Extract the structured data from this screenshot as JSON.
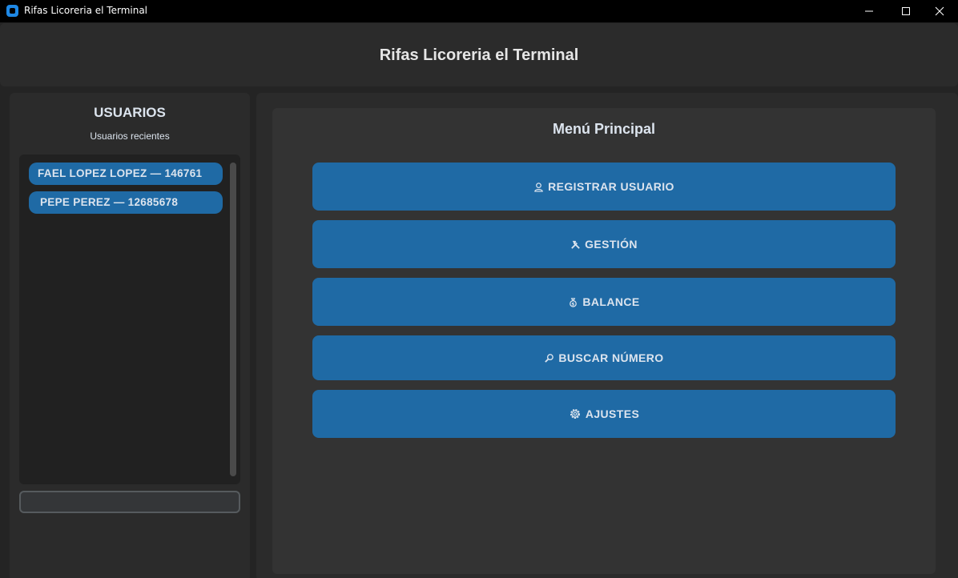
{
  "window": {
    "title": "Rifas Licoreria el Terminal",
    "controls": [
      "minimize-icon",
      "maximize-icon",
      "close-icon"
    ]
  },
  "header": {
    "title": "Rifas Licoreria el Terminal"
  },
  "sidebar": {
    "title": "USUARIOS",
    "subtitle": "Usuarios recientes",
    "users": [
      "FAEL LOPEZ LOPEZ  —  146761",
      "PEPE  PEREZ  —  12685678"
    ],
    "search": {
      "value": "",
      "placeholder": ""
    }
  },
  "main": {
    "title": "Menú Principal",
    "buttons": [
      {
        "label": "REGISTRAR USUARIO",
        "icon": "user-add-icon"
      },
      {
        "label": "GESTIÓN",
        "icon": "tools-icon"
      },
      {
        "label": "BALANCE",
        "icon": "money-bag-icon"
      },
      {
        "label": "BUSCAR NÚMERO",
        "icon": "magnifier-icon"
      },
      {
        "label": "AJUSTES",
        "icon": "gear-icon"
      }
    ]
  },
  "colors": {
    "background": "#242424",
    "panel": "#2b2b2b",
    "accent": "#1f6aa5",
    "text": "#dce4ee"
  }
}
